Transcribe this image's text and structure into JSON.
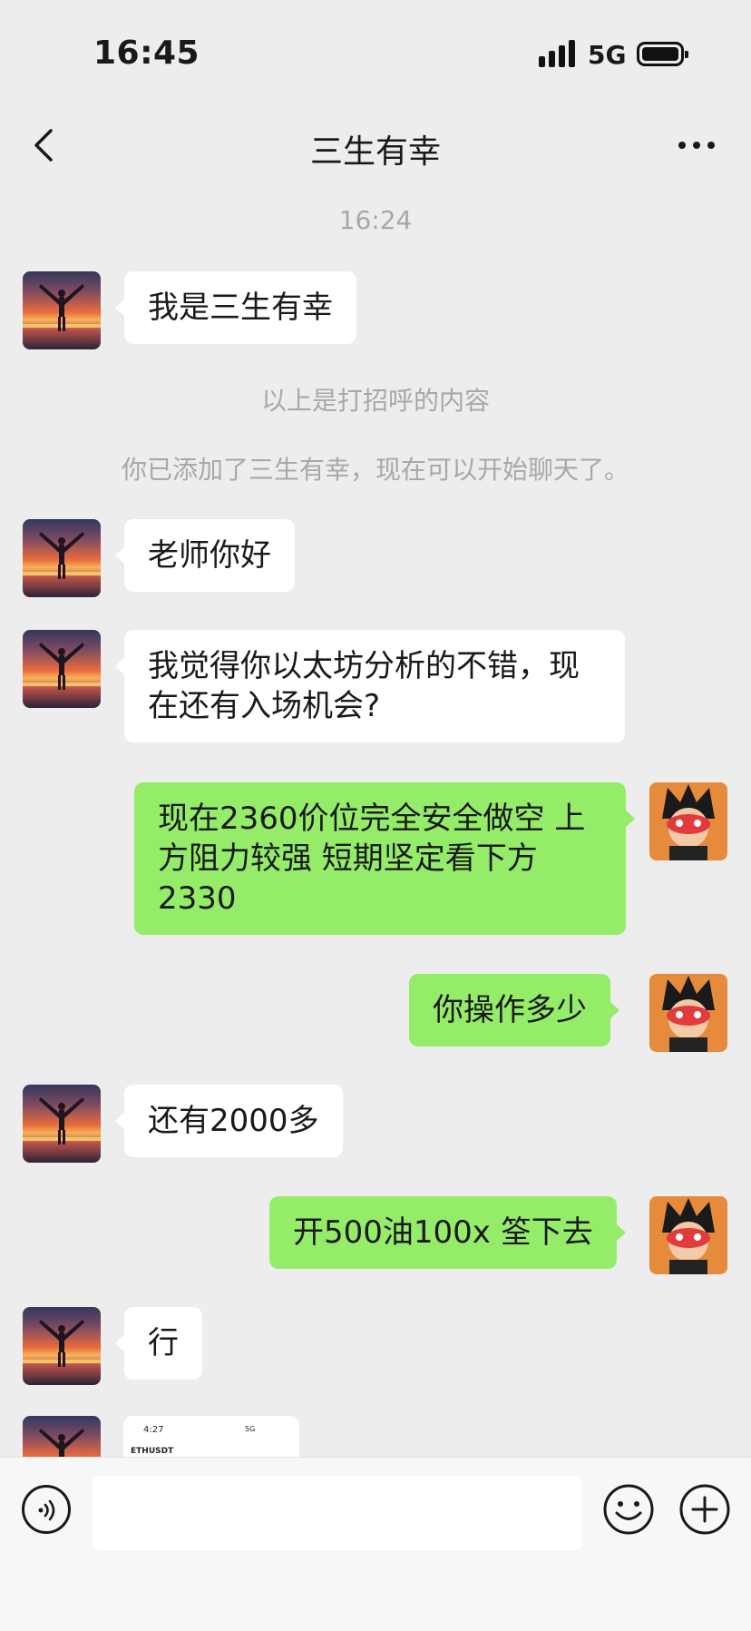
{
  "status_bar": {
    "time": "16:45",
    "network": "5G"
  },
  "nav": {
    "title": "三生有幸"
  },
  "timestamp": "16:24",
  "system_messages": {
    "greeting_note": "以上是打招呼的内容",
    "added_note": "你已添加了三生有幸，现在可以开始聊天了。"
  },
  "messages": [
    {
      "side": "in",
      "text": "我是三生有幸"
    },
    {
      "side": "in",
      "text": "老师你好"
    },
    {
      "side": "in",
      "text": "我觉得你以太坊分析的不错，现在还有入场机会?"
    },
    {
      "side": "out",
      "text": "现在2360价位完全安全做空 上方阻力较强 短期坚定看下方2330"
    },
    {
      "side": "out",
      "text": "你操作多少"
    },
    {
      "side": "in",
      "text": "还有2000多"
    },
    {
      "side": "out",
      "text": "开500油100x 筌下去"
    },
    {
      "side": "in",
      "text": "行"
    }
  ],
  "image_preview": {
    "time": "4:27",
    "network": "5G",
    "symbol": "ETHUSDT"
  },
  "input": {
    "value": ""
  }
}
